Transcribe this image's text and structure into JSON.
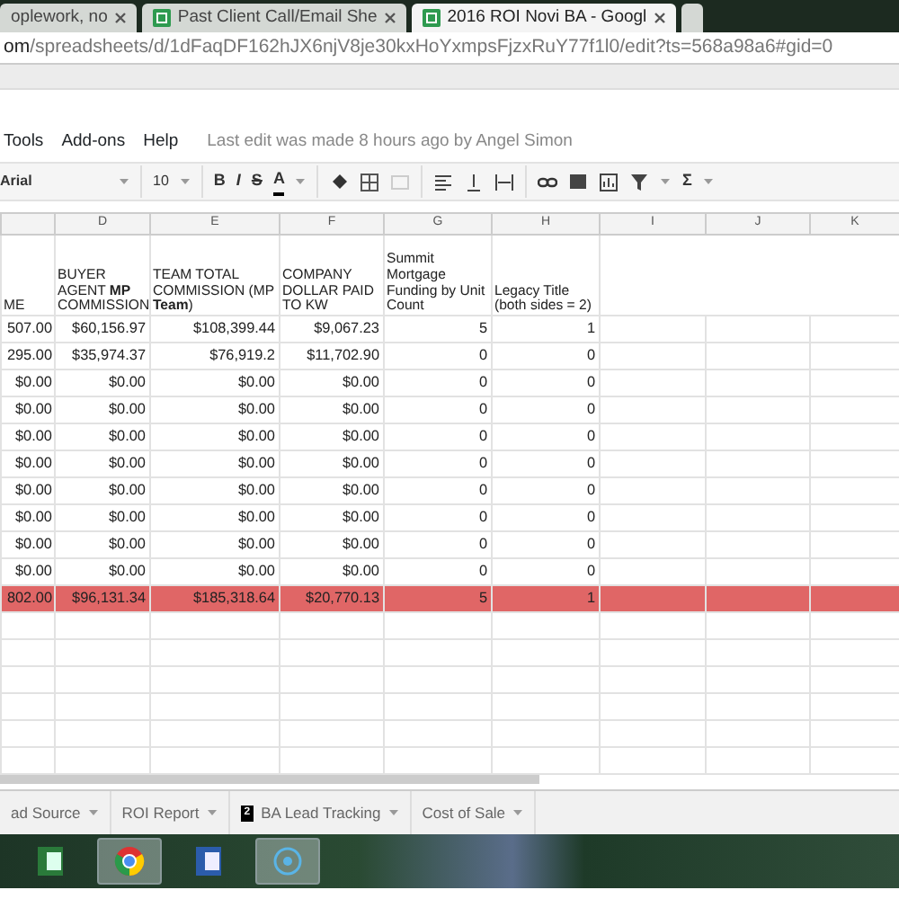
{
  "browser_tabs": [
    {
      "title": "oplework, no",
      "selected": false
    },
    {
      "title": "Past Client Call/Email She",
      "selected": false
    },
    {
      "title": "2016 ROI Novi BA - Googl",
      "selected": true
    }
  ],
  "address": {
    "host_tail": "om",
    "path": "/spreadsheets/d/1dFaqDF162hJX6njV8je30kxHoYxmpsFjzxRuY77f1l0/edit?ts=568a98a6#gid=0"
  },
  "menu": {
    "items": [
      "Tools",
      "Add-ons",
      "Help"
    ],
    "last_edit": "Last edit was made 8 hours ago by Angel Simon"
  },
  "toolbar": {
    "font": "Arial",
    "size": "10",
    "format_glyphs": [
      "B",
      "I",
      "S",
      "A"
    ],
    "sum_glyph": "Σ"
  },
  "sheet": {
    "columns": [
      "",
      "D",
      "E",
      "F",
      "G",
      "H",
      "I",
      "J",
      "K"
    ],
    "header_row": [
      "ME",
      "BUYER AGENT **MP** COMMISSION",
      "TEAM TOTAL COMMISSION (MP **Team**)",
      "COMPANY DOLLAR PAID TO KW",
      "Summit Mortgage Funding by Unit Count",
      "Legacy Title (both sides = 2)"
    ],
    "rows": [
      {
        "total": false,
        "cells": [
          "507.00",
          "$60,156.97",
          "$108,399.44",
          "$9,067.23",
          "5",
          "1"
        ]
      },
      {
        "total": false,
        "cells": [
          "295.00",
          "$35,974.37",
          "$76,919.2",
          "$11,702.90",
          "0",
          "0"
        ]
      },
      {
        "total": false,
        "cells": [
          "$0.00",
          "$0.00",
          "$0.00",
          "$0.00",
          "0",
          "0"
        ]
      },
      {
        "total": false,
        "cells": [
          "$0.00",
          "$0.00",
          "$0.00",
          "$0.00",
          "0",
          "0"
        ]
      },
      {
        "total": false,
        "cells": [
          "$0.00",
          "$0.00",
          "$0.00",
          "$0.00",
          "0",
          "0"
        ]
      },
      {
        "total": false,
        "cells": [
          "$0.00",
          "$0.00",
          "$0.00",
          "$0.00",
          "0",
          "0"
        ]
      },
      {
        "total": false,
        "cells": [
          "$0.00",
          "$0.00",
          "$0.00",
          "$0.00",
          "0",
          "0"
        ]
      },
      {
        "total": false,
        "cells": [
          "$0.00",
          "$0.00",
          "$0.00",
          "$0.00",
          "0",
          "0"
        ]
      },
      {
        "total": false,
        "cells": [
          "$0.00",
          "$0.00",
          "$0.00",
          "$0.00",
          "0",
          "0"
        ]
      },
      {
        "total": false,
        "cells": [
          "$0.00",
          "$0.00",
          "$0.00",
          "$0.00",
          "0",
          "0"
        ]
      },
      {
        "total": true,
        "cells": [
          "802.00",
          "$96,131.34",
          "$185,318.64",
          "$20,770.13",
          "5",
          "1"
        ]
      }
    ]
  },
  "sheet_tabs": [
    {
      "label": "ad Source"
    },
    {
      "label": "ROI Report"
    },
    {
      "label": "BA Lead Tracking",
      "badge": "2"
    },
    {
      "label": "Cost of Sale"
    }
  ],
  "taskbar": [
    {
      "kind": "excel",
      "active": false
    },
    {
      "kind": "chrome",
      "active": true
    },
    {
      "kind": "word",
      "active": false
    },
    {
      "kind": "circle",
      "active": true
    }
  ]
}
